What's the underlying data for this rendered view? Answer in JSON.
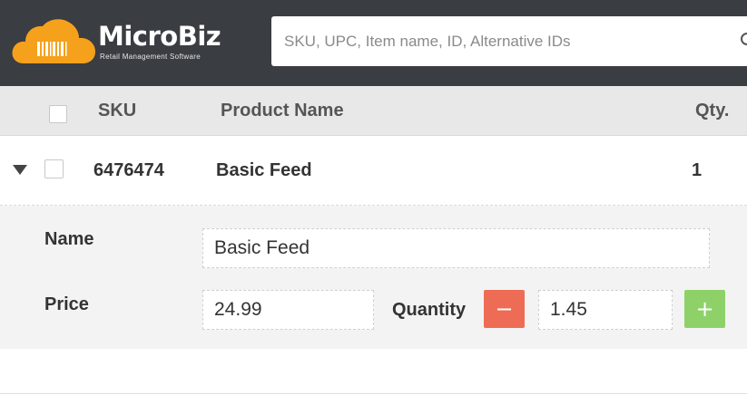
{
  "brand": {
    "name": "MicroBiz",
    "tagline": "Retail Management Software",
    "color": "#f5a11c"
  },
  "search": {
    "placeholder": "SKU, UPC, Item name, ID, Alternative IDs",
    "value": ""
  },
  "table": {
    "columns": {
      "sku": "SKU",
      "product_name": "Product Name",
      "qty": "Qty."
    },
    "rows": [
      {
        "sku": "6476474",
        "product_name": "Basic Feed",
        "qty": "1",
        "checked": false,
        "expanded": true
      }
    ]
  },
  "details": {
    "name_label": "Name",
    "name_value": "Basic Feed",
    "price_label": "Price",
    "price_value": "24.99",
    "quantity_label": "Quantity",
    "quantity_value": "1.45",
    "minus_label": "−",
    "plus_label": "+"
  },
  "colors": {
    "header_bg": "#3a3d42",
    "minus_button": "#ee6c55",
    "plus_button": "#8ed169"
  },
  "icons": {
    "expand": "triangle-down-icon",
    "search": "search-icon",
    "logo": "cloud-barcode-icon"
  }
}
